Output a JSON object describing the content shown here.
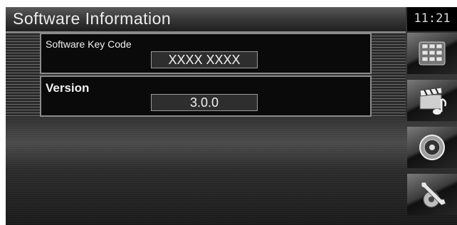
{
  "header": {
    "title": "Software Information",
    "clock": "11:21"
  },
  "software_key": {
    "label": "Software Key Code",
    "value": "XXXX XXXX"
  },
  "version": {
    "label": "Version",
    "value": "3.0.0"
  },
  "side_menu": [
    {
      "name": "source-menu",
      "icon": "keypad-icon"
    },
    {
      "name": "media-menu",
      "icon": "clapperboard-music-icon"
    },
    {
      "name": "audio-menu",
      "icon": "speaker-icon"
    },
    {
      "name": "setup-menu",
      "icon": "wrench-gear-icon"
    }
  ]
}
